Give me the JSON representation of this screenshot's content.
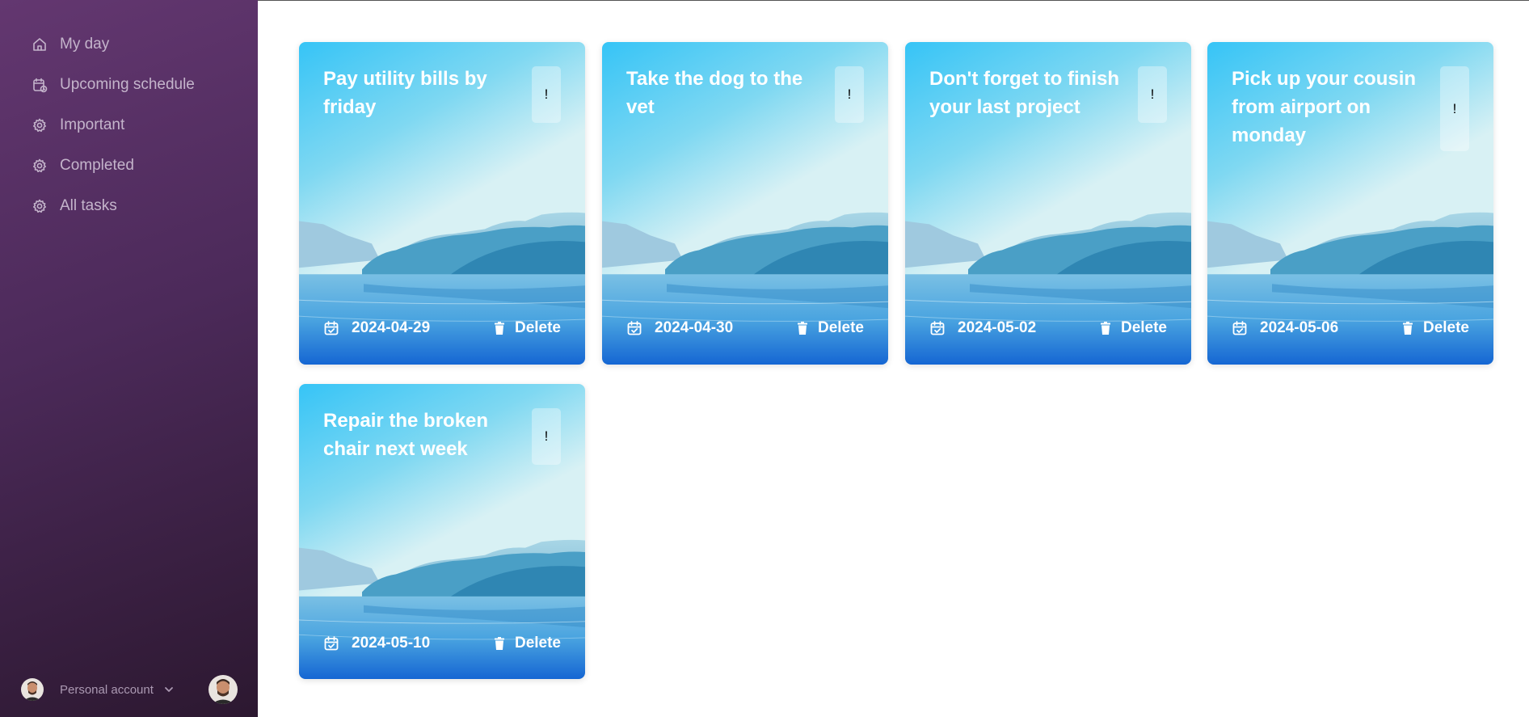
{
  "sidebar": {
    "items": [
      {
        "label": "My day",
        "icon": "home-icon"
      },
      {
        "label": "Upcoming schedule",
        "icon": "calendar-clock-icon"
      },
      {
        "label": "Important",
        "icon": "gear-icon"
      },
      {
        "label": "Completed",
        "icon": "gear-icon"
      },
      {
        "label": "All tasks",
        "icon": "gear-icon"
      }
    ],
    "account": {
      "label": "Personal account"
    }
  },
  "tasks": [
    {
      "title": "Pay utility bills by friday",
      "flag": "!",
      "date": "2024-04-29",
      "delete_label": "Delete"
    },
    {
      "title": "Take the dog to the vet",
      "flag": "!",
      "date": "2024-04-30",
      "delete_label": "Delete"
    },
    {
      "title": "Don't forget to finish your last project",
      "flag": "!",
      "date": "2024-05-02",
      "delete_label": "Delete"
    },
    {
      "title": "Pick up your cousin from airport on monday",
      "flag": "!",
      "date": "2024-05-06",
      "delete_label": "Delete"
    },
    {
      "title": "Repair the broken chair next week",
      "flag": "!",
      "date": "2024-05-10",
      "delete_label": "Delete"
    }
  ],
  "colors": {
    "sidebar_top": "#633770",
    "sidebar_bottom": "#2c1830",
    "nav_text": "#c4b4cb",
    "card_sky": "#36c4f6"
  }
}
